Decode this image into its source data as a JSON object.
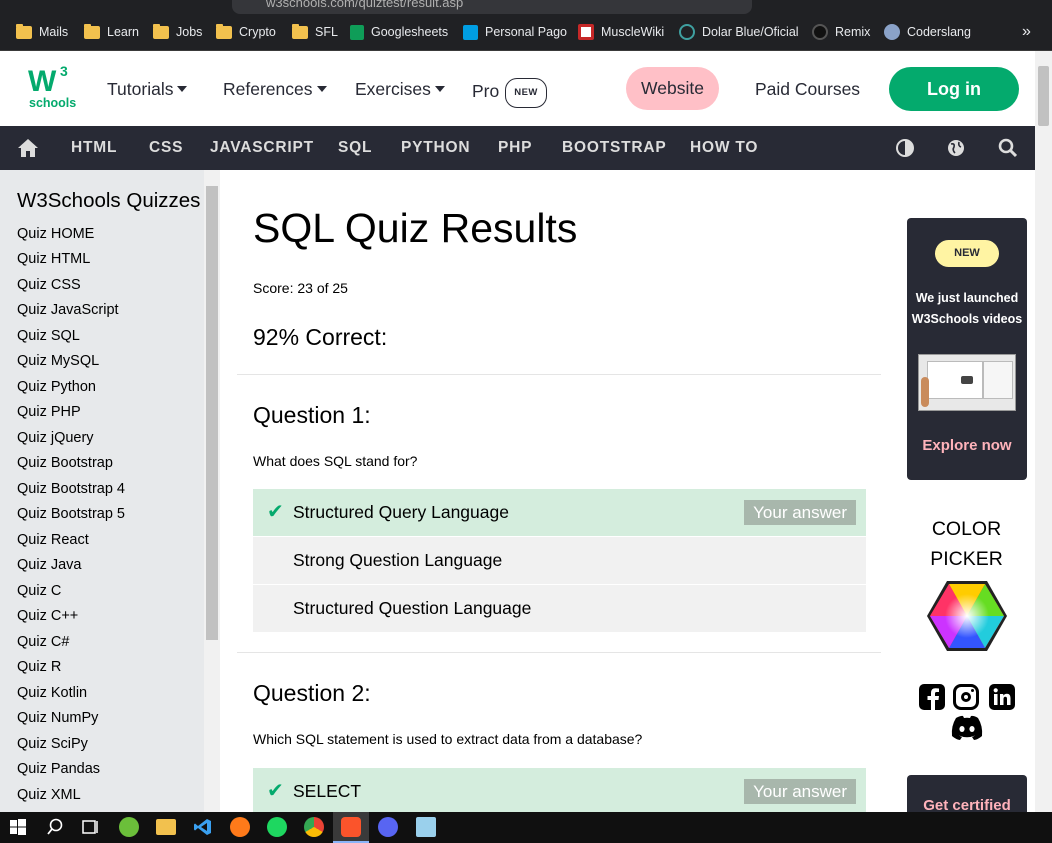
{
  "browser": {
    "url": "w3schools.com/quiztest/result.asp",
    "bookmarks": [
      {
        "label": "Mails",
        "icon": "folder-icon"
      },
      {
        "label": "Learn",
        "icon": "folder-icon"
      },
      {
        "label": "Jobs",
        "icon": "folder-icon"
      },
      {
        "label": "Crypto",
        "icon": "folder-icon"
      },
      {
        "label": "SFL",
        "icon": "folder-icon"
      },
      {
        "label": "Googlesheets",
        "icon": "sheets-icon"
      },
      {
        "label": "Personal Pago",
        "icon": "pago-icon"
      },
      {
        "label": "MuscleWiki",
        "icon": "musclewiki-icon"
      },
      {
        "label": "Dolar Blue/Oficial",
        "icon": "dollar-icon"
      },
      {
        "label": "Remix",
        "icon": "remix-icon"
      },
      {
        "label": "Coderslang",
        "icon": "coderslang-icon"
      }
    ],
    "more_bookmarks": "»"
  },
  "topnav": {
    "logo_text": "schools",
    "logo_mark": "W",
    "logo_sup": "3",
    "tutorials": "Tutorials",
    "references": "References",
    "exercises": "Exercises",
    "pro": "Pro",
    "pro_badge": "NEW",
    "website": "Website",
    "paid_courses": "Paid Courses",
    "login": "Log in"
  },
  "subnav": [
    "HTML",
    "CSS",
    "JAVASCRIPT",
    "SQL",
    "PYTHON",
    "PHP",
    "BOOTSTRAP",
    "HOW TO"
  ],
  "sidebar": {
    "title": "W3Schools Quizzes",
    "items": [
      "Quiz HOME",
      "Quiz HTML",
      "Quiz CSS",
      "Quiz JavaScript",
      "Quiz SQL",
      "Quiz MySQL",
      "Quiz Python",
      "Quiz PHP",
      "Quiz jQuery",
      "Quiz Bootstrap",
      "Quiz Bootstrap 4",
      "Quiz Bootstrap 5",
      "Quiz React",
      "Quiz Java",
      "Quiz C",
      "Quiz C++",
      "Quiz C#",
      "Quiz R",
      "Quiz Kotlin",
      "Quiz NumPy",
      "Quiz SciPy",
      "Quiz Pandas",
      "Quiz XML"
    ]
  },
  "main": {
    "title": "SQL Quiz Results",
    "score": "Score: 23 of 25",
    "percent": "92% Correct:",
    "your_answer": "Your answer",
    "questions": [
      {
        "title": "Question 1:",
        "text": "What does SQL stand for?",
        "answers": [
          "Structured Query Language",
          "Strong Question Language",
          "Structured Question Language"
        ]
      },
      {
        "title": "Question 2:",
        "text": "Which SQL statement is used to extract data from a database?",
        "answers": [
          "SELECT"
        ]
      }
    ]
  },
  "right": {
    "new_badge": "NEW",
    "promo_line1": "We just launched",
    "promo_line2": "W3Schools videos",
    "explore": "Explore now",
    "color_line1": "COLOR",
    "color_line2": "PICKER",
    "certified": "Get certified"
  },
  "colors": {
    "brand_green": "#04aa6d",
    "nav_dark": "#282a35",
    "website_pink": "#ffc0c7",
    "correct_bg": "#d4eddd",
    "sidebar_bg": "#e7e9eb"
  }
}
